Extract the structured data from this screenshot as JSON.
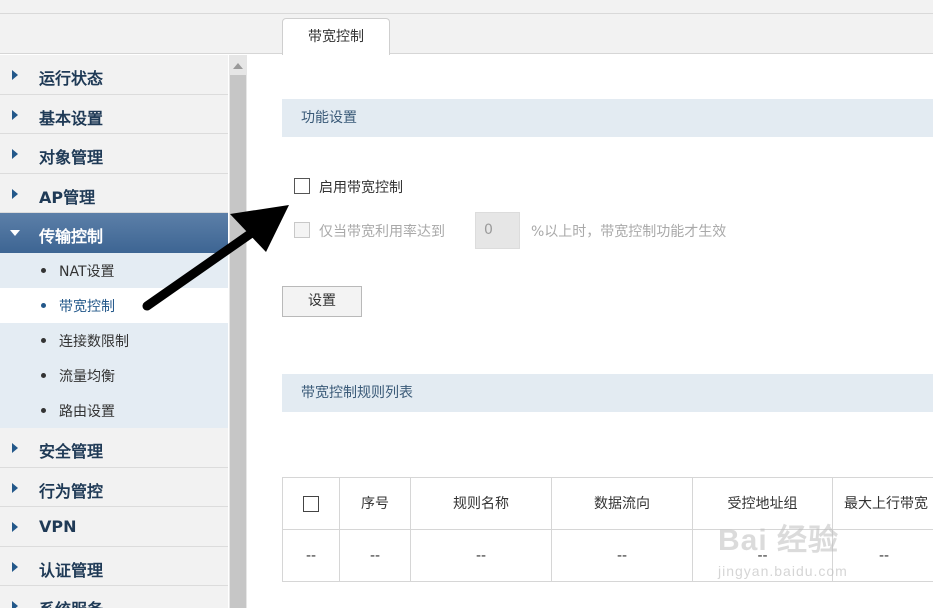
{
  "tab": {
    "label": "带宽控制"
  },
  "sidebar": {
    "items": [
      {
        "label": "运行状态"
      },
      {
        "label": "基本设置"
      },
      {
        "label": "对象管理"
      },
      {
        "label": "AP管理"
      },
      {
        "label": "传输控制",
        "expanded": true,
        "children": [
          {
            "label": "NAT设置"
          },
          {
            "label": "带宽控制",
            "selected": true
          },
          {
            "label": "连接数限制"
          },
          {
            "label": "流量均衡"
          },
          {
            "label": "路由设置"
          }
        ]
      },
      {
        "label": "安全管理"
      },
      {
        "label": "行为管控"
      },
      {
        "label": "VPN"
      },
      {
        "label": "认证管理"
      },
      {
        "label": "系统服务"
      }
    ]
  },
  "function_settings": {
    "header": "功能设置",
    "enable_label": "启用带宽控制",
    "enable_checked": false,
    "threshold_prefix": "仅当带宽利用率达到",
    "threshold_value": "0",
    "threshold_suffix": "%以上时，带宽控制功能才生效",
    "threshold_checked": false,
    "submit_label": "设置"
  },
  "rules_list": {
    "header": "带宽控制规则列表",
    "columns": [
      "序号",
      "规则名称",
      "数据流向",
      "受控地址组",
      "最大上行带宽"
    ],
    "rows": [
      [
        "--",
        "--",
        "--",
        "--",
        "--",
        "--"
      ]
    ]
  },
  "watermark": {
    "main": "Bai 经验",
    "sub": "jingyan.baidu.com"
  },
  "colors": {
    "active_nav": "#3d6593",
    "section_header_bg": "#e3ebf2",
    "annotation_arrow": "#000000"
  }
}
